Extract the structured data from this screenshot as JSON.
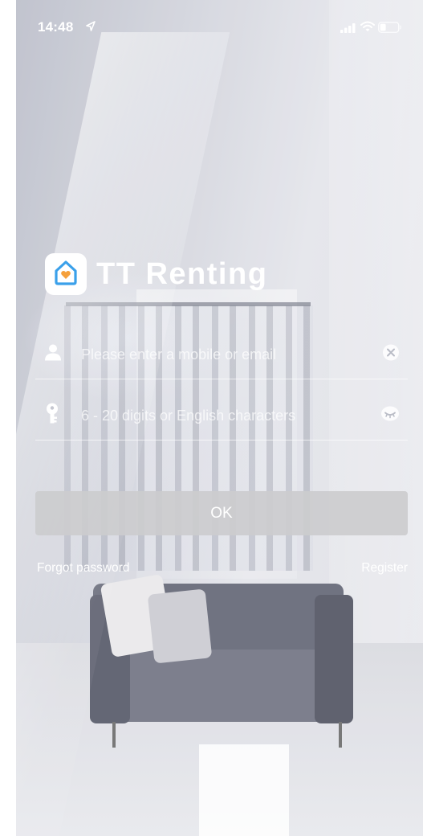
{
  "status_bar": {
    "time": "14:48",
    "location_icon": "location-arrow-icon",
    "signal_icon": "cellular-signal-icon",
    "wifi_icon": "wifi-icon",
    "battery_icon": "battery-icon"
  },
  "brand": {
    "logo_icon": "house-heart-icon",
    "name": "TT Renting"
  },
  "login_form": {
    "account": {
      "icon": "user-icon",
      "placeholder": "Please enter a mobile or email",
      "value": "",
      "action_icon": "clear-icon"
    },
    "password": {
      "icon": "key-icon",
      "placeholder": "6 - 20 digits or English characters",
      "value": "",
      "action_icon": "eye-closed-icon"
    },
    "submit_label": "OK"
  },
  "links": {
    "forgot_password": "Forgot password",
    "register": "Register"
  },
  "colors": {
    "text": "#ffffff",
    "button_bg": "#cdcdcf",
    "logo_blue": "#3aa0ea",
    "logo_heart": "#f5a03c"
  }
}
